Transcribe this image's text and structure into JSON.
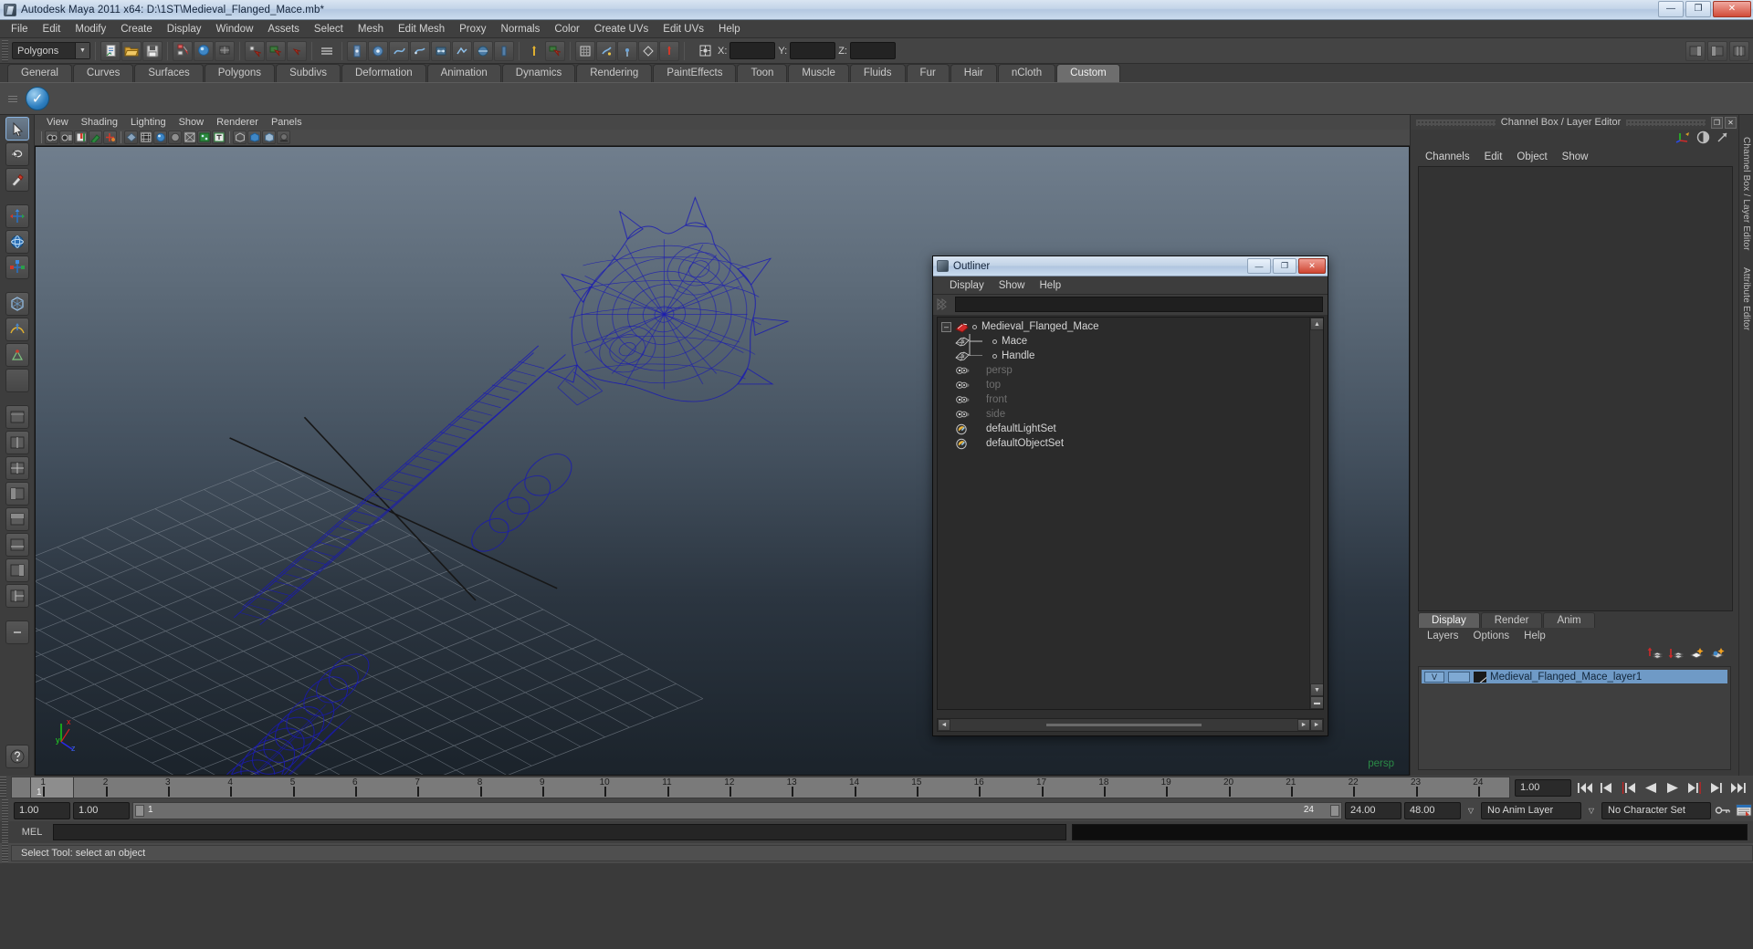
{
  "window": {
    "title": "Autodesk Maya 2011 x64: D:\\1ST\\Medieval_Flanged_Mace.mb*",
    "minimize": "—",
    "maximize": "❐",
    "close": "✕"
  },
  "menubar": {
    "items": [
      "File",
      "Edit",
      "Modify",
      "Create",
      "Display",
      "Window",
      "Assets",
      "Select",
      "Mesh",
      "Edit Mesh",
      "Proxy",
      "Normals",
      "Color",
      "Create UVs",
      "Edit UVs",
      "Help"
    ]
  },
  "statusline": {
    "selection_mode": "Polygons",
    "x_label": "X:",
    "y_label": "Y:",
    "z_label": "Z:",
    "x_value": "",
    "y_value": "",
    "z_value": ""
  },
  "shelf": {
    "tabs": [
      "General",
      "Curves",
      "Surfaces",
      "Polygons",
      "Subdivs",
      "Deformation",
      "Animation",
      "Dynamics",
      "Rendering",
      "PaintEffects",
      "Toon",
      "Muscle",
      "Fluids",
      "Fur",
      "Hair",
      "nCloth",
      "Custom"
    ],
    "active_tab": "Custom"
  },
  "viewport": {
    "menu": [
      "View",
      "Shading",
      "Lighting",
      "Show",
      "Renderer",
      "Panels"
    ],
    "camera_label": "persp",
    "axis": {
      "x": "x",
      "y": "y",
      "z": "z"
    }
  },
  "outliner": {
    "title": "Outliner",
    "minimize": "—",
    "maximize": "❐",
    "close": "✕",
    "menu": [
      "Display",
      "Show",
      "Help"
    ],
    "search_value": "",
    "rows": [
      {
        "label": "Medieval_Flanged_Mace",
        "type": "group",
        "indent": 0,
        "dim": false,
        "expander": "–",
        "connector": "none"
      },
      {
        "label": "Mace",
        "type": "mesh",
        "indent": 1,
        "dim": false,
        "expander": "",
        "connector": "tee"
      },
      {
        "label": "Handle",
        "type": "mesh",
        "indent": 1,
        "dim": false,
        "expander": "",
        "connector": "ell"
      },
      {
        "label": "persp",
        "type": "camera",
        "indent": 1,
        "dim": true,
        "expander": "",
        "connector": "none"
      },
      {
        "label": "top",
        "type": "camera",
        "indent": 1,
        "dim": true,
        "expander": "",
        "connector": "none"
      },
      {
        "label": "front",
        "type": "camera",
        "indent": 1,
        "dim": true,
        "expander": "",
        "connector": "none"
      },
      {
        "label": "side",
        "type": "camera",
        "indent": 1,
        "dim": true,
        "expander": "",
        "connector": "none"
      },
      {
        "label": "defaultLightSet",
        "type": "set",
        "indent": 1,
        "dim": false,
        "expander": "",
        "connector": "none"
      },
      {
        "label": "defaultObjectSet",
        "type": "set",
        "indent": 1,
        "dim": false,
        "expander": "",
        "connector": "none"
      }
    ]
  },
  "channelbox": {
    "panel_title": "Channel Box / Layer Editor",
    "menu": [
      "Channels",
      "Edit",
      "Object",
      "Show"
    ],
    "restore": "❐",
    "close": "✕"
  },
  "layer_editor": {
    "tabs": [
      "Display",
      "Render",
      "Anim"
    ],
    "active_tab": "Display",
    "menu": [
      "Layers",
      "Options",
      "Help"
    ],
    "layers": [
      {
        "visibility": "V",
        "playback": "",
        "name": "Medieval_Flanged_Mace_layer1",
        "selected": true
      }
    ]
  },
  "side_tabs": [
    "Channel Box / Layer Editor",
    "Attribute Editor"
  ],
  "timeline": {
    "ticks": [
      1,
      2,
      3,
      4,
      5,
      6,
      7,
      8,
      9,
      10,
      11,
      12,
      13,
      14,
      15,
      16,
      17,
      18,
      19,
      20,
      21,
      22,
      23,
      24
    ],
    "current_frame_label": "1",
    "current_frame_field": "1.00",
    "playback_buttons": [
      "go-to-start",
      "step-back-key",
      "step-back-frame",
      "play-backwards",
      "play-forwards",
      "step-forward-frame",
      "step-forward-key",
      "go-to-end"
    ]
  },
  "range_slider": {
    "anim_start": "1.00",
    "range_start": "1.00",
    "range_bar_start": "1",
    "range_bar_end": "24",
    "range_end": "24.00",
    "anim_end": "48.00",
    "anim_layer": "No Anim Layer",
    "character_set": "No Character Set"
  },
  "command_line": {
    "language": "MEL",
    "input_value": "",
    "output_value": ""
  },
  "help_line": {
    "text": "Select Tool: select an object"
  },
  "colors": {
    "accent_blue": "#1b1ba8",
    "title_gradient_top": "#d9e5f2",
    "persp_green": "#2a8a46",
    "layer_selected": "#6f9ac6"
  }
}
